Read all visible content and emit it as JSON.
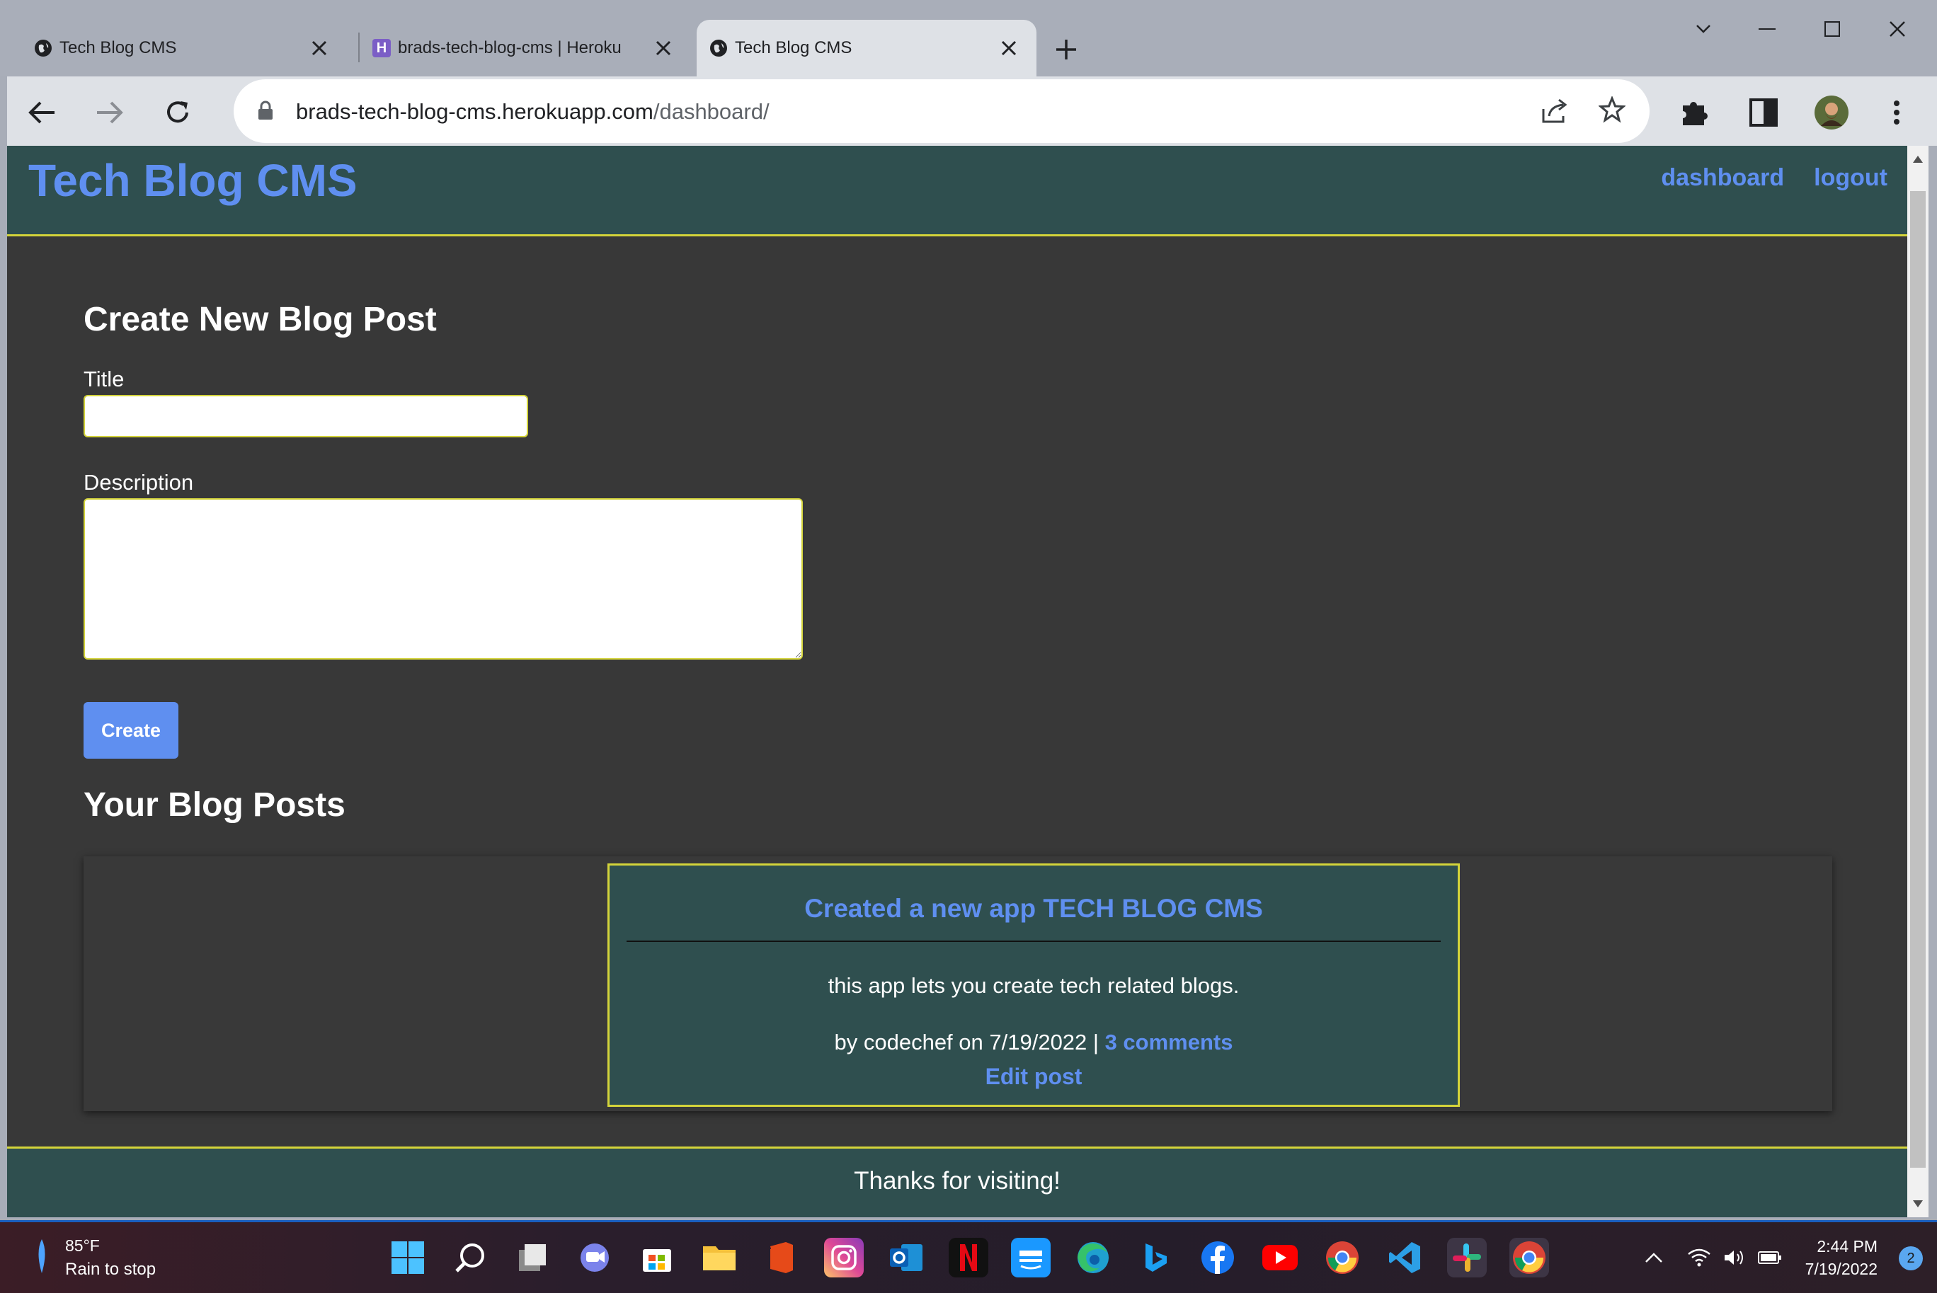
{
  "browser": {
    "tabs": [
      {
        "title": "Tech Blog CMS",
        "active": false
      },
      {
        "title": "brads-tech-blog-cms | Heroku",
        "active": false
      },
      {
        "title": "Tech Blog CMS",
        "active": true
      }
    ],
    "url_domain": "brads-tech-blog-cms.herokuapp.com",
    "url_path": "/dashboard/"
  },
  "site": {
    "title": "Tech Blog CMS",
    "nav": {
      "dashboard": "dashboard",
      "logout": "logout"
    }
  },
  "form": {
    "heading": "Create New Blog Post",
    "title_label": "Title",
    "title_value": "",
    "description_label": "Description",
    "description_value": "",
    "submit_label": "Create"
  },
  "posts": {
    "heading": "Your Blog Posts",
    "items": [
      {
        "title": "Created a new app TECH BLOG CMS",
        "body": "this app lets you create tech related blogs.",
        "meta_prefix": "by codechef on 7/19/2022 | ",
        "comments_link": "3 comments",
        "edit_link": "Edit post"
      }
    ]
  },
  "footer": {
    "text": "Thanks for visiting!"
  },
  "taskbar": {
    "weather_temp": "85°F",
    "weather_condition": "Rain to stop",
    "time": "2:44 PM",
    "date": "7/19/2022",
    "notifications": "2"
  },
  "colors": {
    "accent": "#5f8ff0",
    "header_bg": "#2f4f4f",
    "page_bg": "#383838",
    "border": "#d4d43a"
  }
}
